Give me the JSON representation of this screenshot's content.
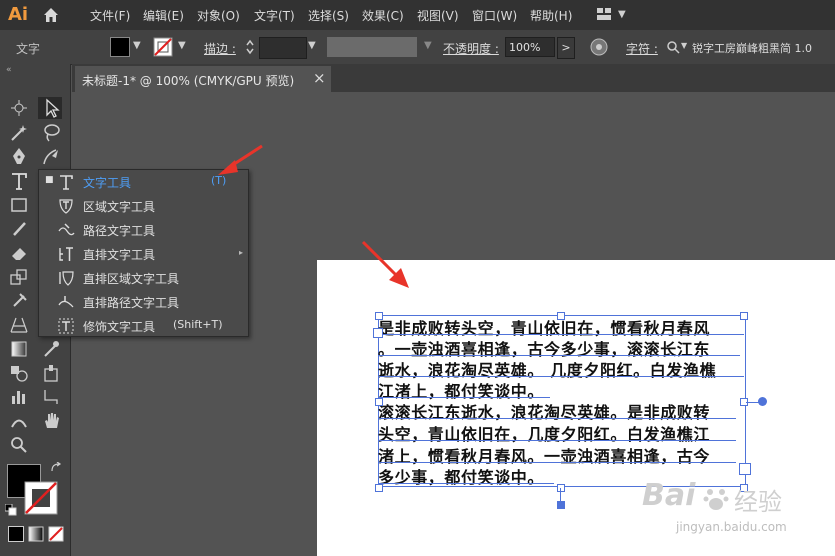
{
  "app": {
    "logo": "Ai"
  },
  "menu": [
    "文件(F)",
    "编辑(E)",
    "对象(O)",
    "文字(T)",
    "选择(S)",
    "效果(C)",
    "视图(V)",
    "窗口(W)",
    "帮助(H)"
  ],
  "control_bar": {
    "section_label": "文字",
    "stroke_label": "描边 :",
    "opacity_label": "不透明度 :",
    "opacity_value": "100%",
    "char_label": "字符 :",
    "font_name": "锐字工房巅峰粗黑简 1.0"
  },
  "document_tab": {
    "title": "未标题-1* @ 100% (CMYK/GPU 预览)",
    "close": "×"
  },
  "flyout": {
    "items": [
      {
        "label": "文字工具",
        "shortcut": "(T)",
        "active": true
      },
      {
        "label": "区域文字工具",
        "shortcut": ""
      },
      {
        "label": "路径文字工具",
        "shortcut": ""
      },
      {
        "label": "直排文字工具",
        "shortcut": ""
      },
      {
        "label": "直排区域文字工具",
        "shortcut": ""
      },
      {
        "label": "直排路径文字工具",
        "shortcut": ""
      },
      {
        "label": "修饰文字工具",
        "shortcut": "(Shift+T)"
      }
    ]
  },
  "text_content": {
    "lines": [
      "是非成败转头空，青山依旧在，惯看秋月春风",
      "。一壶浊酒喜相逢，古今多少事，滚滚长江东",
      "逝水，浪花淘尽英雄。 几度夕阳红。白发渔樵",
      "江渚上，都付笑谈中。",
      "滚滚长江东逝水，浪花淘尽英雄。是非成败转",
      "头空，青山依旧在，几度夕阳红。白发渔樵江",
      "渚上，惯看秋月春风。一壶浊酒喜相逢，古今",
      "多少事，都付笑谈中。"
    ]
  },
  "watermark": {
    "text1": "Bai",
    "text2": "经验",
    "url": "jingyan.baidu.com"
  },
  "colors": {
    "accent": "#4f73d9",
    "flyout_active": "#4e9ef5",
    "arrow": "#e8342a"
  }
}
